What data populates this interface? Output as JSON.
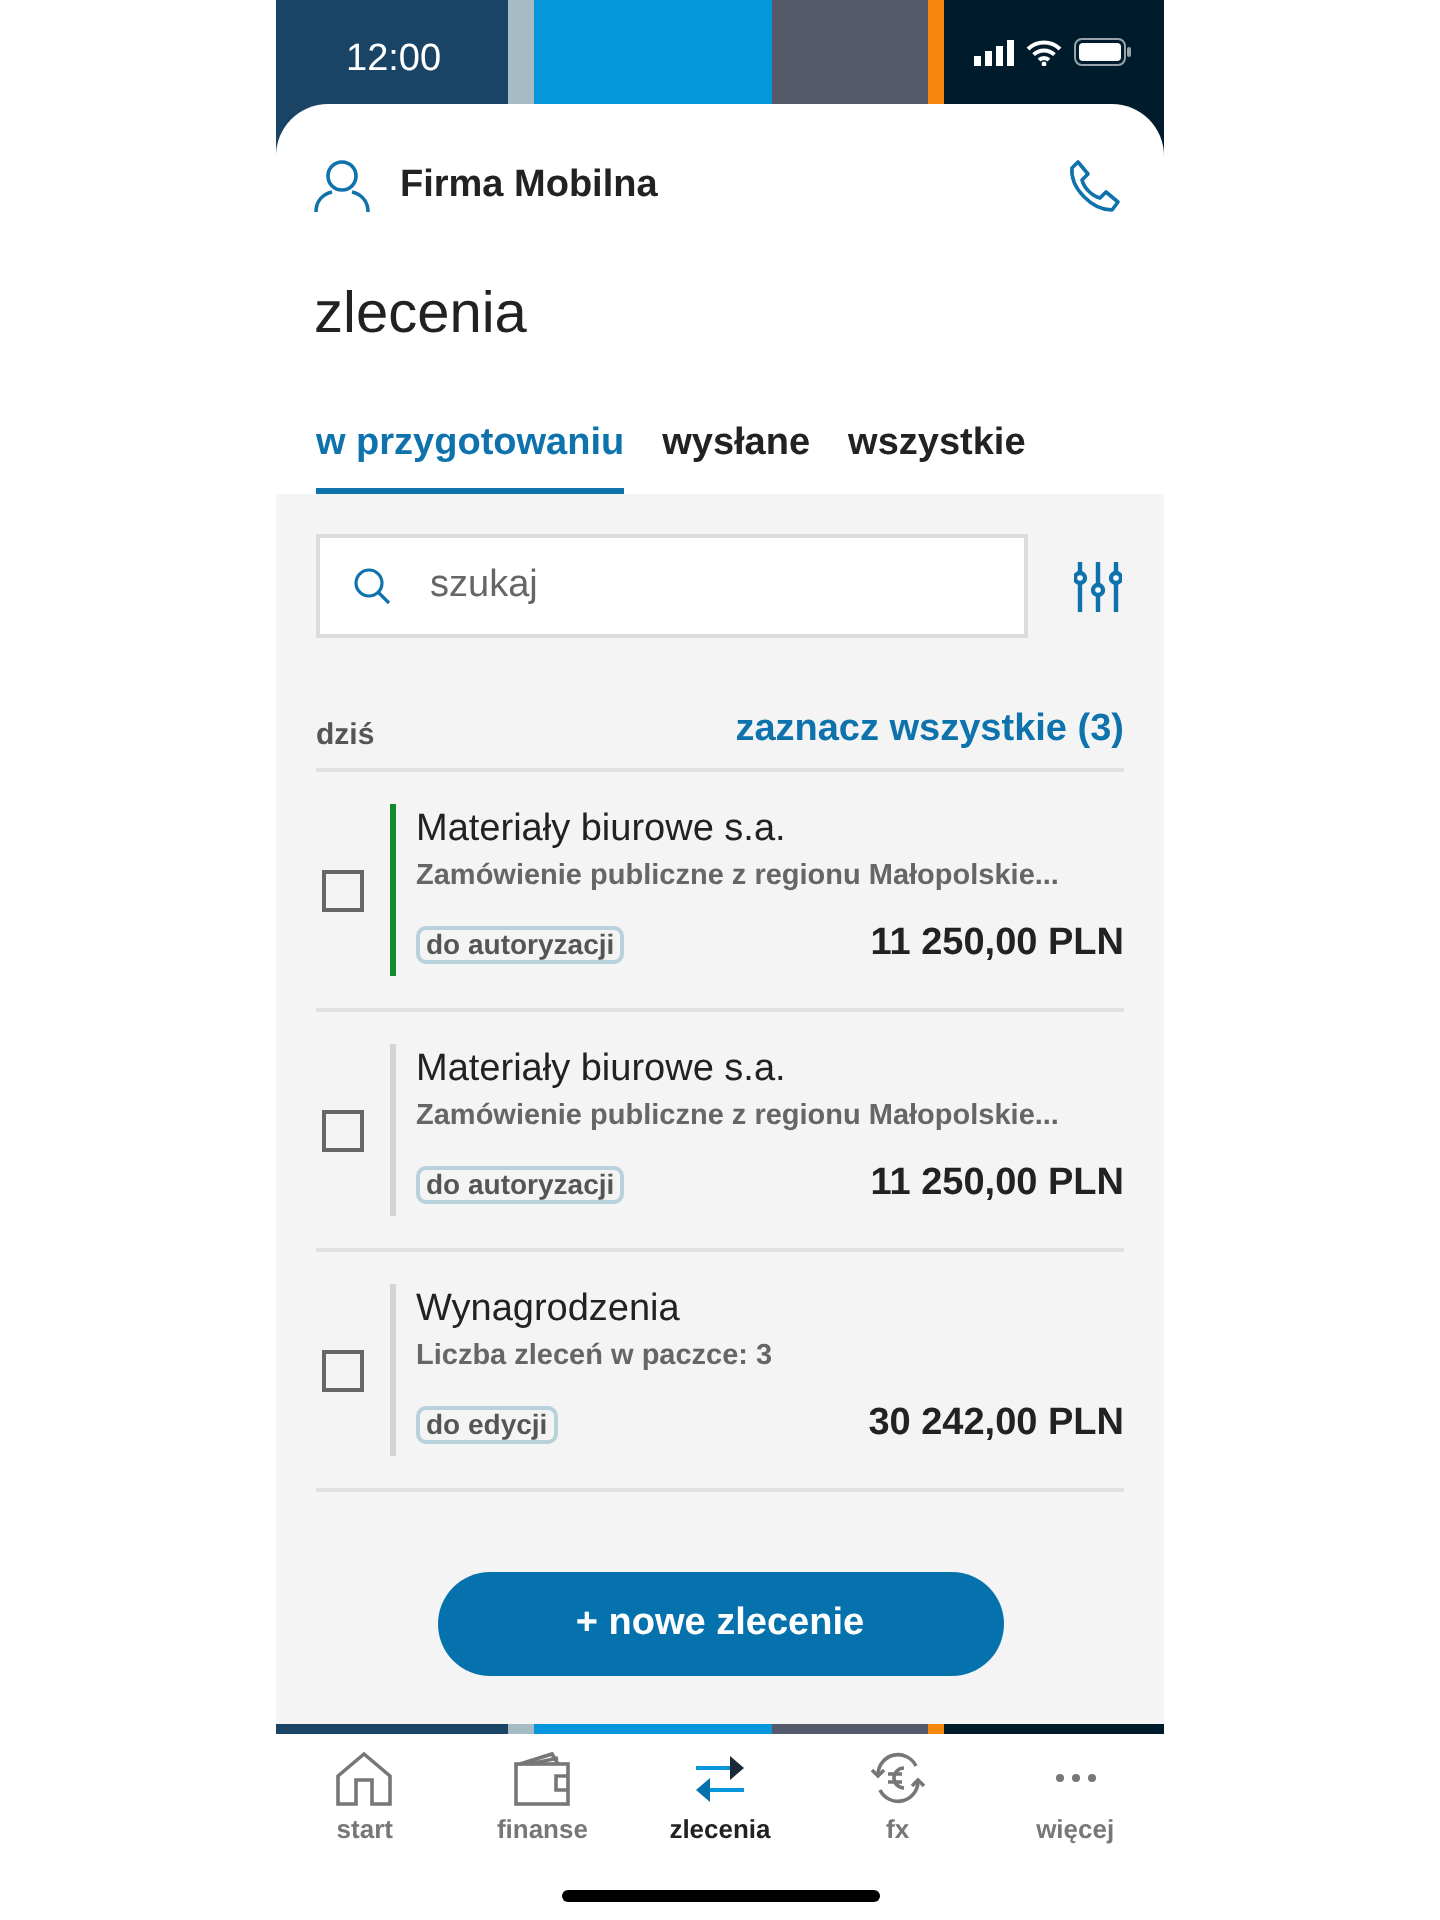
{
  "status_bar": {
    "time": "12:00"
  },
  "header": {
    "company": "Firma Mobilna"
  },
  "title": "zlecenia",
  "tabs": [
    {
      "label": "w przygotowaniu",
      "selected": true
    },
    {
      "label": "wysłane",
      "selected": false
    },
    {
      "label": "wszystkie",
      "selected": false
    }
  ],
  "search": {
    "placeholder": "szukaj"
  },
  "section": {
    "label": "dziś",
    "select_all": "zaznacz wszystkie (3)"
  },
  "orders": [
    {
      "name": "Materiały biurowe s.a.",
      "description": "Zamówienie publiczne z regionu Małopolskie...",
      "status": "do autoryzacji",
      "amount": "11 250,00 PLN",
      "checked": false,
      "color": "#138a2e"
    },
    {
      "name": "Materiały biurowe s.a.",
      "description": "Zamówienie publiczne z regionu Małopolskie...",
      "status": "do autoryzacji",
      "amount": "11 250,00 PLN",
      "checked": false,
      "color": "#d4d4d4"
    },
    {
      "name": "Wynagrodzenia",
      "description": "Liczba zleceń w paczce: 3",
      "status": "do edycji",
      "amount": "30 242,00 PLN",
      "checked": false,
      "color": "#d4d4d4"
    }
  ],
  "new_order_button": "+ nowe zlecenie",
  "nav": [
    {
      "label": "start",
      "kind": "home",
      "selected": false
    },
    {
      "label": "finanse",
      "kind": "wallet",
      "selected": false
    },
    {
      "label": "zlecenia",
      "kind": "transfer",
      "selected": true
    },
    {
      "label": "fx",
      "kind": "exchange",
      "selected": false
    },
    {
      "label": "więcej",
      "kind": "more",
      "selected": false
    }
  ]
}
